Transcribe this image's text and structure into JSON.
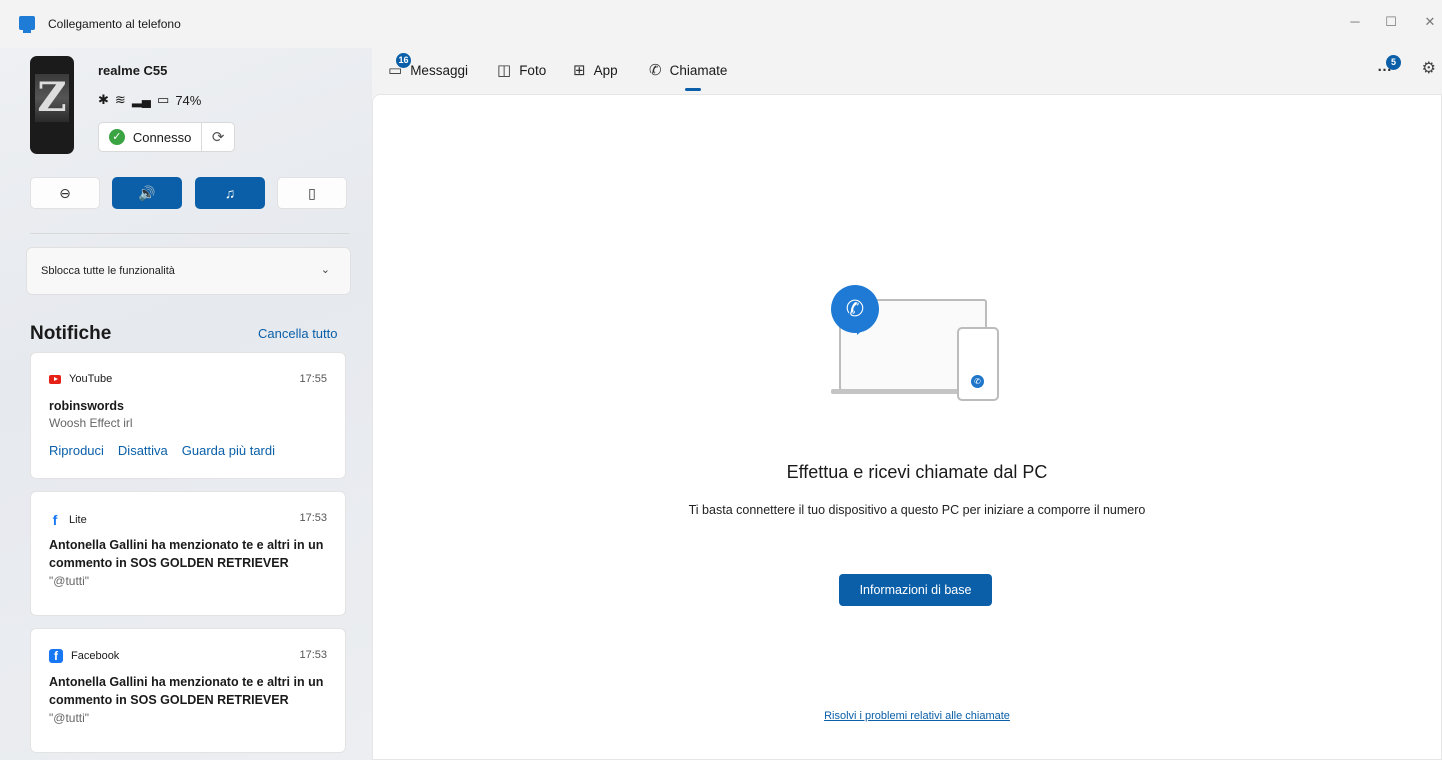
{
  "window": {
    "title": "Collegamento al telefono",
    "controls": [
      "─",
      "☐",
      "✕"
    ]
  },
  "device": {
    "name": "realme C55",
    "battery": "74%",
    "status_label": "Connesso"
  },
  "quick_actions": [
    {
      "name": "do-not-disturb",
      "icon": "⊖",
      "active": false
    },
    {
      "name": "sound",
      "icon": "🔊",
      "active": true
    },
    {
      "name": "music",
      "icon": "♫",
      "active": true
    },
    {
      "name": "phone-audio",
      "icon": "▯",
      "active": false
    }
  ],
  "unlock": {
    "label": "Sblocca tutte le funzionalità"
  },
  "notifications": {
    "title": "Notifiche",
    "clear_all": "Cancella tutto",
    "items": [
      {
        "app": "YouTube",
        "time": "17:55",
        "title": "robinswords",
        "body": "Woosh Effect irl",
        "actions": [
          "Riproduci",
          "Disattiva",
          "Guarda più tardi"
        ]
      },
      {
        "app": "Lite",
        "time": "17:53",
        "title": "Antonella Gallini ha menzionato te e altri in un commento in SOS GOLDEN RETRIEVER",
        "body": "\"@tutti\""
      },
      {
        "app": "Facebook",
        "time": "17:53",
        "title": "Antonella Gallini ha menzionato te e altri in un commento in SOS GOLDEN RETRIEVER",
        "body": "\"@tutti\""
      }
    ]
  },
  "tabs": [
    {
      "label": "Messaggi",
      "badge": "16"
    },
    {
      "label": "Foto"
    },
    {
      "label": "App"
    },
    {
      "label": "Chiamate",
      "active": true
    }
  ],
  "header": {
    "more_badge": "5"
  },
  "calls": {
    "heading": "Effettua e ricevi chiamate dal PC",
    "subtitle": "Ti basta connettere il tuo dispositivo a questo PC per iniziare a comporre il numero",
    "cta": "Informazioni di base",
    "troubleshoot": "Risolvi i problemi relativi alle chiamate"
  }
}
